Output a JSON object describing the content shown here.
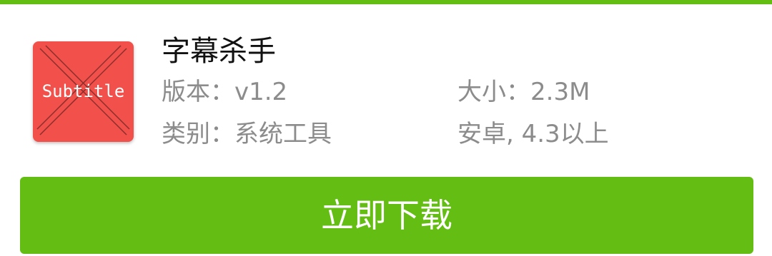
{
  "colors": {
    "accent": "#63bd12",
    "icon_background": "#f2504a",
    "meta_text": "#8c8c8c"
  },
  "app": {
    "icon_text": "Subtitle",
    "name": "字幕杀手",
    "version": "版本：v1.2",
    "size": "大小：2.3M",
    "category": "类别：系统工具",
    "os": "安卓, 4.3以上"
  },
  "download": {
    "label": "立即下载"
  }
}
